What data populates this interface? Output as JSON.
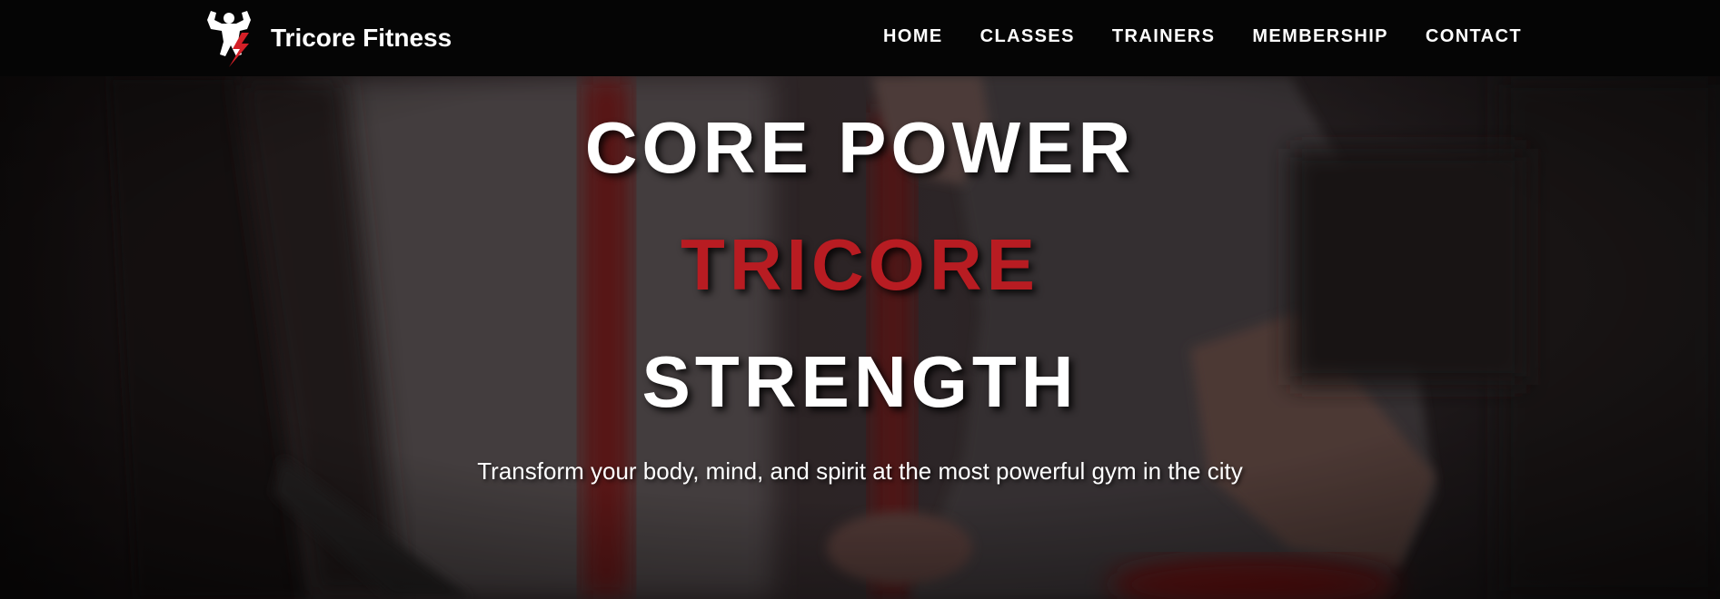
{
  "brand": {
    "name": "Tricore Fitness",
    "logo_icon": "flexing-bodybuilder-lightning-icon"
  },
  "nav": {
    "items": [
      {
        "label": "HOME"
      },
      {
        "label": "CLASSES"
      },
      {
        "label": "TRAINERS"
      },
      {
        "label": "MEMBERSHIP"
      },
      {
        "label": "CONTACT"
      }
    ]
  },
  "hero": {
    "line1": "CORE POWER",
    "line2": "TRICORE",
    "line3": "STRENGTH",
    "tagline": "Transform your body, mind, and spirit at the most powerful gym in the city",
    "background": "man-running-on-treadmill-photo"
  },
  "colors": {
    "nav_bg": "#050505",
    "accent_red": "#b81c22",
    "text_white": "#ffffff"
  }
}
